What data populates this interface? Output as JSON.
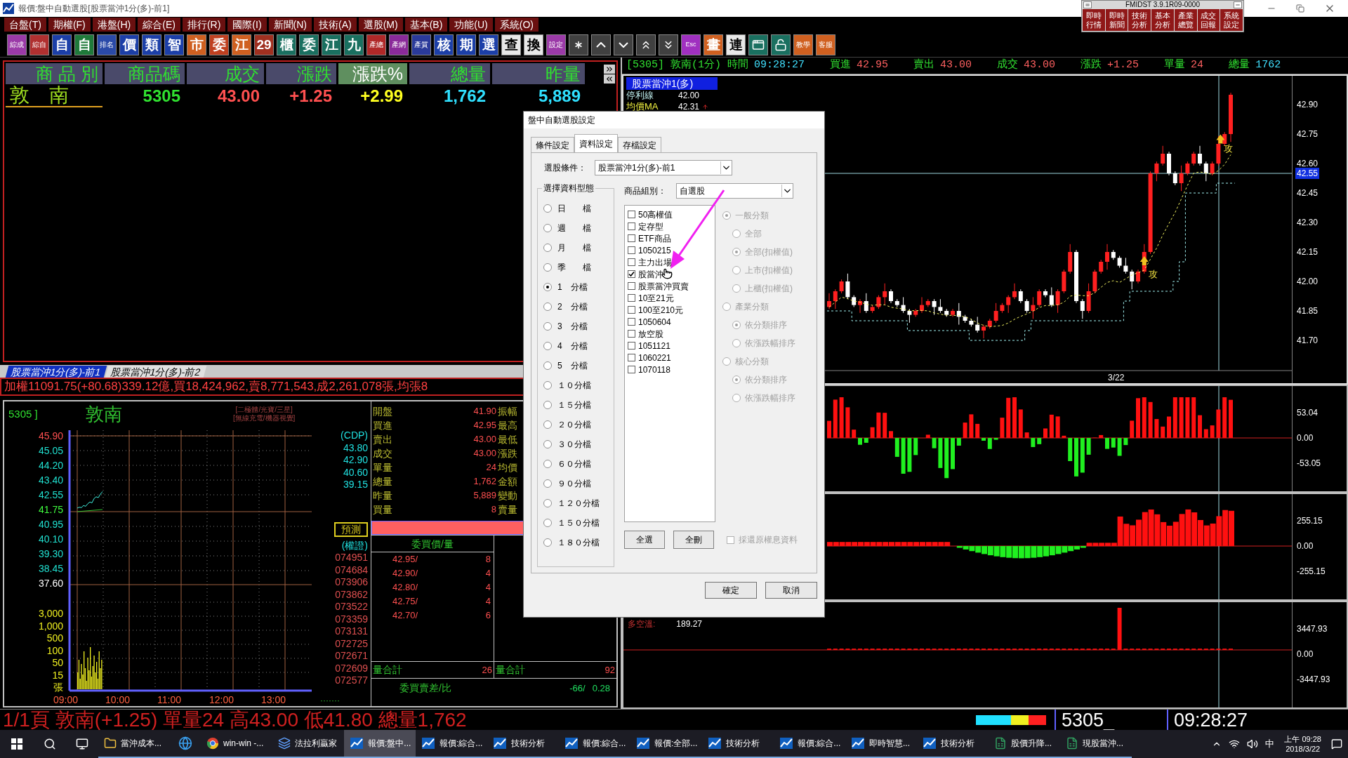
{
  "window": {
    "title": "報價:盤中自動選股[股票當沖1分(多)-前1]"
  },
  "fmidst": {
    "title": "FMIDST 3.9.1R09-0000",
    "buttons": [
      "即時行情",
      "即時新聞",
      "技術分析",
      "基本分析",
      "產業總覽",
      "成交回報",
      "系統設定"
    ]
  },
  "menu": [
    "台盤(T)",
    "期權(F)",
    "港盤(H)",
    "綜合(E)",
    "排行(R)",
    "國際(I)",
    "新聞(N)",
    "技術(A)",
    "選股(M)",
    "基本(B)",
    "功能(U)",
    "系統(O)"
  ],
  "toolbar": [
    {
      "kind": "small",
      "label": "綜成",
      "color": "#9b3aa8"
    },
    {
      "kind": "small",
      "label": "綜自",
      "color": "#b03030"
    },
    {
      "kind": "glyph",
      "label": "自",
      "color": "#1c3fa8"
    },
    {
      "kind": "glyph",
      "label": "自",
      "color": "#1f7a3a"
    },
    {
      "kind": "small",
      "label": "排名",
      "color": "#2a4aa8"
    },
    {
      "kind": "glyph",
      "label": "價",
      "color": "#1c3fa8"
    },
    {
      "kind": "glyph",
      "label": "類",
      "color": "#1c3fa8"
    },
    {
      "kind": "glyph",
      "label": "智",
      "color": "#1c3fa8"
    },
    {
      "kind": "glyph",
      "label": "市",
      "color": "#d06020"
    },
    {
      "kind": "glyph",
      "label": "委",
      "color": "#c04020"
    },
    {
      "kind": "glyph",
      "label": "江",
      "color": "#d06020"
    },
    {
      "kind": "glyph",
      "label": "29",
      "color": "#a03020"
    },
    {
      "kind": "glyph",
      "label": "櫃",
      "color": "#1a7060"
    },
    {
      "kind": "glyph",
      "label": "委",
      "color": "#1a7060"
    },
    {
      "kind": "glyph",
      "label": "江",
      "color": "#1a7060"
    },
    {
      "kind": "glyph",
      "label": "九",
      "color": "#1a7060"
    },
    {
      "kind": "small",
      "label": "產總",
      "color": "#b02828"
    },
    {
      "kind": "small",
      "label": "產網",
      "color": "#8a2a9a"
    },
    {
      "kind": "small",
      "label": "產質",
      "color": "#2a3a9a"
    },
    {
      "kind": "glyph",
      "label": "核",
      "color": "#1c3fa8"
    },
    {
      "kind": "glyph",
      "label": "期",
      "color": "#1c3fa8"
    },
    {
      "kind": "glyph",
      "label": "選",
      "color": "#1c3fa8"
    },
    {
      "kind": "light",
      "label": "查",
      "color": "#e8e8e8"
    },
    {
      "kind": "light",
      "label": "換",
      "color": "#e8e8e8"
    },
    {
      "kind": "small",
      "label": "設定",
      "color": "#9b3aa8"
    },
    {
      "kind": "star",
      "color": "#404040"
    },
    {
      "kind": "up",
      "color": "#404040"
    },
    {
      "kind": "down",
      "color": "#404040"
    },
    {
      "kind": "up2",
      "color": "#404040"
    },
    {
      "kind": "down2",
      "color": "#404040"
    },
    {
      "kind": "esc",
      "label": "Esc",
      "color": "#a030c0"
    },
    {
      "kind": "glyph",
      "label": "畫",
      "color": "#d06020"
    },
    {
      "kind": "light",
      "label": "連",
      "color": "#e8e8e8"
    },
    {
      "kind": "window",
      "color": "#1a7060"
    },
    {
      "kind": "lock",
      "color": "#1a7060"
    },
    {
      "kind": "small",
      "label": "教學",
      "color": "#d06020"
    },
    {
      "kind": "small",
      "label": "客服",
      "color": "#d06020"
    }
  ],
  "quote_table": {
    "columns": [
      {
        "label": "商 品 別",
        "selected": false
      },
      {
        "label": "商品碼",
        "selected": false
      },
      {
        "label": "成交",
        "selected": false
      },
      {
        "label": "漲跌",
        "selected": false
      },
      {
        "label": "漲跌%",
        "selected": true
      },
      {
        "label": "總量",
        "selected": false
      },
      {
        "label": "昨量",
        "selected": false
      }
    ],
    "row": [
      {
        "text": "敦　南",
        "color": "#a0e020"
      },
      {
        "text": "5305",
        "color": "#30e030"
      },
      {
        "text": "43.00",
        "color": "#ff5050"
      },
      {
        "text": "+1.25",
        "color": "#ff5050"
      },
      {
        "text": "+2.99",
        "color": "#ffff20"
      },
      {
        "text": "1,762",
        "color": "#30e0ff"
      },
      {
        "text": "5,889",
        "color": "#30e0ff"
      }
    ]
  },
  "tabs": [
    {
      "label": "股票當沖1分(多)-前1",
      "selected": true
    },
    {
      "label": "股票當沖1分(多)-前2",
      "selected": false
    }
  ],
  "index_line": "加權11091.75(+80.68)339.12億,買18,424,962,賣8,771,543,成2,261,078張,均張8",
  "intraday": {
    "code": "5305 ]",
    "name": "敦南",
    "tags": [
      "[二極體/光寶/三星]",
      "[無線充電/機器視覺]"
    ],
    "price_ticks": [
      {
        "text": "45.90",
        "color": "#ff5050"
      },
      {
        "text": "45.05",
        "color": "#20e0d0"
      },
      {
        "text": "44.20",
        "color": "#20e0d0"
      },
      {
        "text": "43.40",
        "color": "#20e0d0"
      },
      {
        "text": "42.55",
        "color": "#20e0d0"
      },
      {
        "text": "41.75",
        "color": "#40ff40"
      },
      {
        "text": "40.95",
        "color": "#20e0d0"
      },
      {
        "text": "40.10",
        "color": "#20e0d0"
      },
      {
        "text": "39.30",
        "color": "#20e0d0"
      },
      {
        "text": "38.45",
        "color": "#20e0d0"
      },
      {
        "text": "37.60",
        "color": "#ffffff"
      }
    ],
    "volume_ticks": [
      "3,000",
      "1,000",
      "500",
      "100",
      "50",
      "15",
      "張"
    ],
    "time_ticks": [
      "09:00",
      "10:00",
      "11:00",
      "12:00",
      "13:00"
    ],
    "more": "·······",
    "cdp_title": "(CDP)",
    "cdp_values": [
      "43.80",
      "42.90",
      "40.60",
      "39.15"
    ],
    "forecast": "預測",
    "warrant_title": "(權證)",
    "warrant_codes": [
      "074951",
      "074684",
      "073906",
      "073862",
      "073522",
      "073359",
      "073131",
      "072725",
      "072671",
      "072609",
      "072577"
    ]
  },
  "quote_details": {
    "rows": [
      {
        "label": "開盤",
        "value": "41.90",
        "label2": "振幅"
      },
      {
        "label": "買進",
        "value": "42.95",
        "label2": "最高"
      },
      {
        "label": "賣出",
        "value": "43.00",
        "label2": "最低"
      },
      {
        "label": "成交",
        "value": "43.00",
        "label2": "漲跌"
      },
      {
        "label": "單量",
        "value": "24",
        "label2": "均價"
      },
      {
        "label": "總量",
        "value": "1,762",
        "label2": "金額"
      },
      {
        "label": "昨量",
        "value": "5,889",
        "label2": "變動"
      },
      {
        "label": "買量",
        "value": "8",
        "label2": "賣量"
      }
    ],
    "bid_title": "委買價/量",
    "bids": [
      {
        "price": "42.95/",
        "qty": "8"
      },
      {
        "price": "42.90/",
        "qty": "4"
      },
      {
        "price": "42.80/",
        "qty": "4"
      },
      {
        "price": "42.75/",
        "qty": "4"
      },
      {
        "price": "42.70/",
        "qty": "6"
      }
    ],
    "totals": [
      {
        "label": "量合計",
        "value": "26"
      },
      {
        "label": "量合計",
        "value": "92"
      }
    ],
    "diff": {
      "label": "委買賣差/比",
      "value": "-66/",
      "ratio": "0.28"
    }
  },
  "chart_header": {
    "title": "[5305] 敦南(1分) 時間",
    "time": "09:28:27",
    "fields": [
      {
        "label": "買進",
        "value": "42.95",
        "color": "#ff6060"
      },
      {
        "label": "賣出",
        "value": "43.00",
        "color": "#ff6060"
      },
      {
        "label": "成交",
        "value": "43.00",
        "color": "#ff6060"
      },
      {
        "label": "漲跌",
        "value": "+1.25",
        "color": "#ff6060"
      },
      {
        "label": "單量",
        "value": "24",
        "color": "#ff6060"
      },
      {
        "label": "總量",
        "value": "1762",
        "color": "#40e0ff"
      }
    ]
  },
  "chart": {
    "strategy": "股票當沖1(多)",
    "legend": [
      {
        "label": "停利線",
        "value": "42.00"
      },
      {
        "label": "均價MA",
        "value": "42.31"
      }
    ],
    "price_ticks": [
      "42.90",
      "42.75",
      "42.60",
      "42.45",
      "42.30",
      "42.15",
      "42.00",
      "41.85",
      "41.70"
    ],
    "current": "42.55",
    "signals": [
      "攻",
      "攻"
    ],
    "date": "3/22",
    "panels": [
      {
        "ticks": [
          "53.04",
          "0.00",
          "-53.05"
        ]
      },
      {
        "ticks": [
          "255.15",
          "0.00",
          "-255.15"
        ]
      },
      {
        "label": "多空溫:",
        "value": "189.27",
        "ticks": [
          "3447.93",
          "0.00",
          "-3447.93"
        ]
      }
    ]
  },
  "dialog": {
    "title": "盤中自動選股設定",
    "tabs": [
      {
        "label": "條件設定",
        "selected": false
      },
      {
        "label": "資料設定",
        "selected": true
      },
      {
        "label": "存檔設定",
        "selected": false
      }
    ],
    "condition_label": "選股條件：",
    "condition_value": "股票當沖1分(多)-前1",
    "types_title": "選擇資料型態",
    "types": [
      {
        "label": "日　　檔",
        "selected": false
      },
      {
        "label": "週　　檔",
        "selected": false
      },
      {
        "label": "月　　檔",
        "selected": false
      },
      {
        "label": "季　　檔",
        "selected": false
      },
      {
        "label": "1　分檔",
        "selected": true
      },
      {
        "label": "2　分檔",
        "selected": false
      },
      {
        "label": "3　分檔",
        "selected": false
      },
      {
        "label": "4　分檔",
        "selected": false
      },
      {
        "label": "5　分檔",
        "selected": false
      },
      {
        "label": "１０分檔",
        "selected": false
      },
      {
        "label": "１５分檔",
        "selected": false
      },
      {
        "label": "２０分檔",
        "selected": false
      },
      {
        "label": "３０分檔",
        "selected": false
      },
      {
        "label": "６０分檔",
        "selected": false
      },
      {
        "label": "９０分檔",
        "selected": false
      },
      {
        "label": "１２０分檔",
        "selected": false
      },
      {
        "label": "１５０分檔",
        "selected": false
      },
      {
        "label": "１８０分檔",
        "selected": false
      }
    ],
    "group_label": "商品組別：",
    "group_value": "自選股",
    "groups": [
      {
        "label": "50高權值",
        "checked": false
      },
      {
        "label": "定存型",
        "checked": false
      },
      {
        "label": "ETF商品",
        "checked": false
      },
      {
        "label": "1050215",
        "checked": false
      },
      {
        "label": "主力出場",
        "checked": false
      },
      {
        "label": "股當沖",
        "checked": true
      },
      {
        "label": "股票當沖買賣",
        "checked": false
      },
      {
        "label": "10至21元",
        "checked": false
      },
      {
        "label": "100至210元",
        "checked": false
      },
      {
        "label": "1050604",
        "checked": false
      },
      {
        "label": "放空股",
        "checked": false
      },
      {
        "label": "1051121",
        "checked": false
      },
      {
        "label": "1060221",
        "checked": false
      },
      {
        "label": "1070118",
        "checked": false
      }
    ],
    "sort": {
      "disabled": true,
      "options": [
        {
          "label": "一般分類",
          "selected": true,
          "children": [
            {
              "label": "全部",
              "selected": false
            },
            {
              "label": "全部(扣權值)",
              "selected": true
            },
            {
              "label": "上市(扣權值)",
              "selected": false
            },
            {
              "label": "上櫃(扣權值)",
              "selected": false
            }
          ]
        },
        {
          "label": "產業分類",
          "selected": false,
          "children": [
            {
              "label": "依分類排序",
              "selected": true
            },
            {
              "label": "依漲跌幅排序",
              "selected": false
            }
          ]
        },
        {
          "label": "核心分類",
          "selected": false,
          "children": [
            {
              "label": "依分類排序",
              "selected": true
            },
            {
              "label": "依漲跌幅排序",
              "selected": false
            }
          ]
        }
      ]
    },
    "restore": {
      "label": "採還原權息資料",
      "checked": false,
      "disabled": true
    },
    "list_buttons": [
      "全選",
      "全刪"
    ],
    "buttons": [
      "確定",
      "取消"
    ]
  },
  "ticker": {
    "text": "1/1頁 敦南(+1.25) 單量24 高43.00 低41.80 總量1,762",
    "code": "5305_",
    "time": "09:28:27"
  },
  "taskbar": {
    "items": [
      {
        "kind": "folder",
        "label": "當沖成本...",
        "selected": false
      },
      {
        "kind": "ie",
        "selected": false
      },
      {
        "kind": "chrome",
        "label": "win-win -...",
        "selected": false
      },
      {
        "kind": "app",
        "label": "法拉利贏家",
        "selected": false
      },
      {
        "kind": "chart",
        "label": "報價:盤中...",
        "selected": true
      },
      {
        "kind": "chart",
        "label": "報價:綜合...",
        "selected": false
      },
      {
        "kind": "chart",
        "label": "技術分析",
        "selected": false
      },
      {
        "kind": "chart",
        "label": "報價:綜合...",
        "selected": false
      },
      {
        "kind": "chart",
        "label": "報價:全部...",
        "selected": false
      },
      {
        "kind": "chart",
        "label": "技術分析",
        "selected": false
      },
      {
        "kind": "chart",
        "label": "報價:綜合...",
        "selected": false
      },
      {
        "kind": "chart",
        "label": "即時智慧...",
        "selected": false
      },
      {
        "kind": "chart",
        "label": "技術分析",
        "selected": false
      },
      {
        "kind": "excel",
        "label": "股價升降...",
        "selected": false
      },
      {
        "kind": "excel",
        "label": "現股當沖...",
        "selected": false
      }
    ],
    "ime": "中",
    "time": "上午 09:28",
    "date": "2018/3/22"
  }
}
